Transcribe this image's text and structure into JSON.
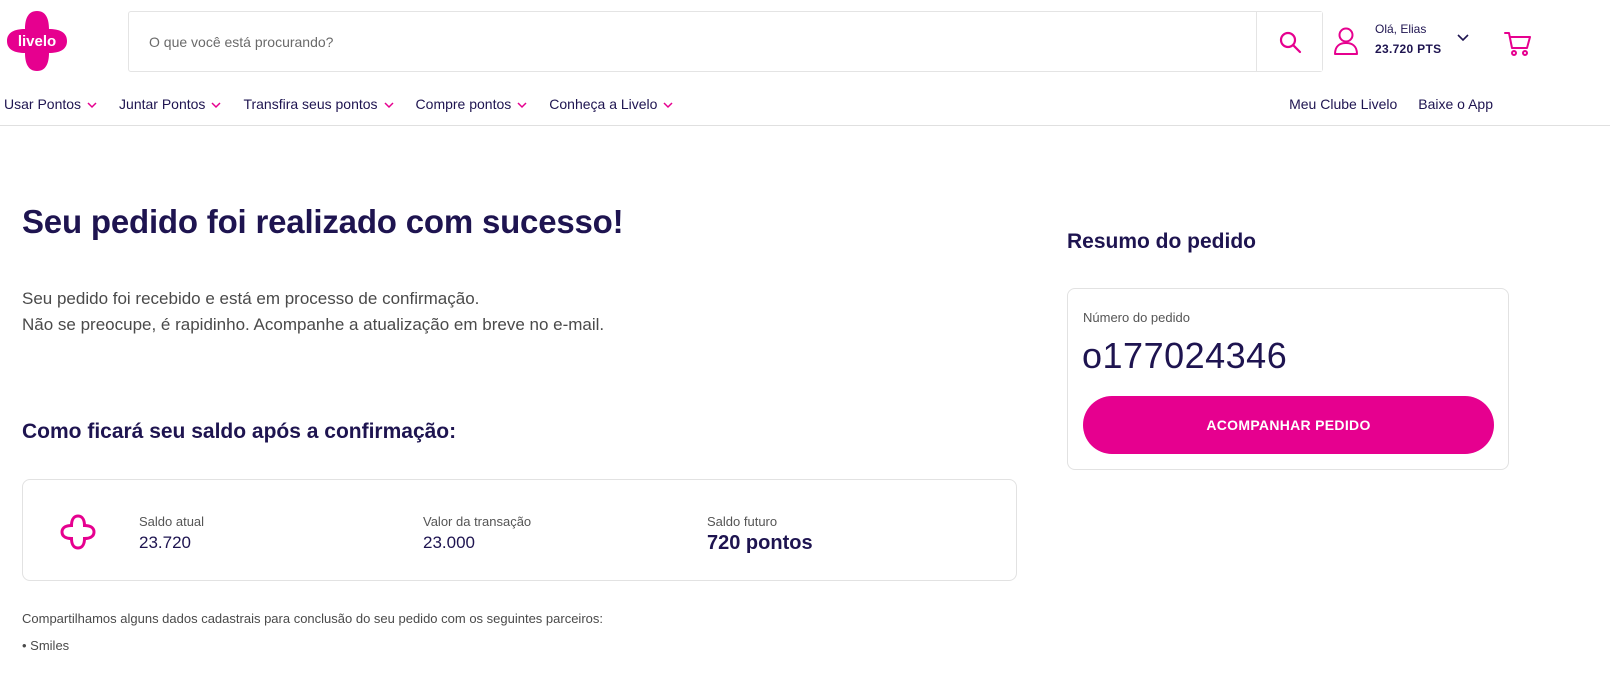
{
  "header": {
    "logo_text": "livelo",
    "search_placeholder": "O que você está procurando?",
    "user_greeting": "Olá, Elias",
    "user_points": "23.720 PTS"
  },
  "nav": {
    "items": [
      {
        "label": "Usar Pontos"
      },
      {
        "label": "Juntar Pontos"
      },
      {
        "label": "Transfira seus pontos"
      },
      {
        "label": "Compre pontos"
      },
      {
        "label": "Conheça a Livelo"
      }
    ],
    "links": [
      {
        "label": "Meu Clube Livelo"
      },
      {
        "label": "Baixe o App"
      }
    ]
  },
  "main": {
    "title": "Seu pedido foi realizado com sucesso!",
    "message_line1": "Seu pedido foi recebido e está em processo de confirmação.",
    "message_line2": "Não se preocupe, é rapidinho. Acompanhe a atualização em breve no e-mail.",
    "balance_heading": "Como ficará seu saldo após a confirmação:",
    "balance": {
      "current_label": "Saldo atual",
      "current_value": "23.720",
      "transaction_label": "Valor da transação",
      "transaction_value": "23.000",
      "future_label": "Saldo futuro",
      "future_value": "720 pontos"
    },
    "share_note": "Compartilhamos alguns dados cadastrais para conclusão do seu pedido com os seguintes parceiros:",
    "partners": [
      "• Smiles"
    ]
  },
  "summary": {
    "heading": "Resumo do pedido",
    "order_label": "Número do pedido",
    "order_number": "o177024346",
    "track_button": "ACOMPANHAR PEDIDO"
  },
  "colors": {
    "brand_pink": "#e6008f",
    "text_navy": "#1e1450"
  },
  "icons": [
    "livelo-logo",
    "search-icon",
    "user-icon",
    "chevron-down-icon",
    "cart-icon"
  ]
}
